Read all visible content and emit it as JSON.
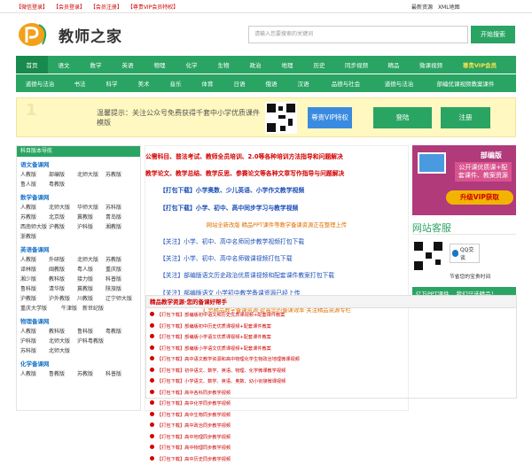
{
  "topbar": {
    "links": [
      "【微信登录】",
      "【会员登录】",
      "【会员注册】",
      "【尊贵VIP会员特权】"
    ],
    "right_links": [
      "最新资源",
      "XML地图"
    ]
  },
  "header": {
    "logo_text": "教师之家",
    "search_placeholder": "请输入您要搜索的关键词",
    "search_button": "开始搜索"
  },
  "nav_primary": [
    "首页",
    "语文",
    "数学",
    "英语",
    "物理",
    "化学",
    "生物",
    "政治",
    "地理",
    "历史",
    "同步视频",
    "精品",
    "微课视频",
    "尊贵VIP会员"
  ],
  "nav_secondary": [
    "道德与法治",
    "书法",
    "科学",
    "美术",
    "音乐",
    "体育",
    "日语",
    "俄语",
    "汉语",
    "品德与社会",
    "道德与法治",
    "部编优课视频教案课件"
  ],
  "banner": {
    "number": "1",
    "notice": "温馨提示：关注公众号免费获得千套中小学优质课件模版",
    "vip_button": "尊贵VIP特权",
    "login_button": "登陆",
    "register_button": "注册"
  },
  "sidebar": {
    "title": "科目版本导航",
    "categories": [
      {
        "name": "语文备课网",
        "items": [
          "人教版",
          "部编版",
          "北师大版",
          "苏教版",
          "鲁人版",
          "粤教版"
        ]
      },
      {
        "name": "数学备课网",
        "items": [
          "人教版",
          "北师大版",
          "华师大版",
          "苏科版",
          "苏教版",
          "北京版",
          "冀教版",
          "青岛版",
          "西南师大版",
          "沪教版",
          "沪科版",
          "湘教版",
          "浙教版"
        ]
      },
      {
        "name": "英语备课网",
        "items": [
          "人教版",
          "外研版",
          "北师大版",
          "苏教版",
          "译林版",
          "闽教版",
          "粤人版",
          "重庆版",
          "湘少版",
          "教科版",
          "接力版",
          "科普版",
          "鲁科版",
          "清华版",
          "冀教版",
          "陕旅版",
          "沪教版",
          "沪外教版",
          "川教版",
          "辽宁师大版",
          "重庆大学版",
          "牛津版",
          "新世纪版"
        ]
      },
      {
        "name": "物理备课网",
        "items": [
          "人教版",
          "教科版",
          "鲁科版",
          "粤教版",
          "沪科版",
          "北师大版",
          "沪科粤教版",
          "苏科版",
          "北师大版"
        ]
      },
      {
        "name": "化学备课网",
        "items": [
          "人教版",
          "鲁教版",
          "苏教版",
          "科普版"
        ]
      }
    ]
  },
  "center_lines": [
    {
      "text": "公需科目、普法考试、教师全员培训、2.0等各种培训方法指导和问题解决",
      "style": "red"
    },
    {
      "text": "教学论文、教学总结、教学反思、参赛论文等各种文章写作指导与问题解决",
      "style": "red"
    },
    {
      "text": "【打包下载】小学奥数、少儿英语、小学作文教学视频",
      "style": "blue"
    },
    {
      "text": "【打包下载】小学、初中、高中同步学习与教学视频",
      "style": "blue"
    },
    {
      "text": "网站全新改版 精品PPT课件等教学备课资源正在整理上传",
      "style": "orange"
    },
    {
      "text": "【关注】小学、初中、高中名师同步教学视频打包下载",
      "style": "bl2"
    },
    {
      "text": "【关注】小学、初中、高中名师微课视频打包下载",
      "style": "bl2"
    },
    {
      "text": "【关注】部编版语文历史政治优质课视频和配套课件教案打包下载",
      "style": "bl2"
    },
    {
      "text": "【关注】部编版语文 小学初中教学备课资源已经上传",
      "style": "bl2"
    },
    {
      "text": "汇总精品教学备课资源·提高您的备课效率·关注精品资源专栏",
      "style": "orange"
    }
  ],
  "right_panel": {
    "ad_title": "部编版",
    "ad_sub": "公开课优质课+配套课件、教案资源",
    "ad_button": "升级VIP获取",
    "service_title": "网站客服",
    "qq_label": "QQ交谈",
    "service_note": "节省您的宝贵时间",
    "greenbar_items": [
      "亿万PPT课件",
      "我们只选精品！"
    ]
  },
  "bottom": {
    "title": "精品教学资源·您的备课好帮手",
    "items": [
      "【打包下载】部编版初中语文和历史优质课视频+配套课件教案",
      "【打包下载】部编版初中历史优质课视频+配套课件教案",
      "【打包下载】部编版小学语文优质课视频+配套课件教案",
      "【打包下载】部编版小学语文优质课视频+配套课件教案",
      "【打包下载】高中语文教学资源和高中物理化学生物政治地理微课视频",
      "【打包下载】初中语文、数学、英语、物理、化学微课教学视频",
      "【打包下载】小学语文、数学、英语、奥数、幼小衔接微课视频",
      "【打包下载】高中各科同步教学视频",
      "【打包下载】高中化学同步教学视频",
      "【打包下载】高中生物同步教学视频",
      "【打包下载】高中政治同步教学视频",
      "【打包下载】高中地理同步教学视频",
      "【打包下载】高中物理同步教学视频",
      "【打包下载】高中历史同步教学视频"
    ]
  }
}
